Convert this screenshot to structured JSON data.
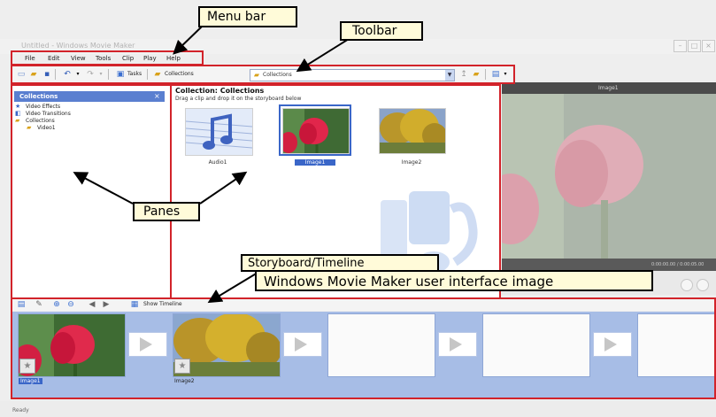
{
  "window": {
    "title": "Untitled - Windows Movie Maker",
    "controls": [
      "minimize",
      "maximize",
      "close"
    ]
  },
  "menu": {
    "items": [
      "File",
      "Edit",
      "View",
      "Tools",
      "Clip",
      "Play",
      "Help"
    ]
  },
  "toolbar": {
    "tasks_label": "Tasks",
    "collections_label": "Collections",
    "collection_combo_value": "Collections"
  },
  "collections_pane": {
    "title": "Collections",
    "tree": [
      {
        "label": "Video Effects",
        "icon": "star-icon",
        "level": 0
      },
      {
        "label": "Video Transitions",
        "icon": "transition-icon",
        "level": 0
      },
      {
        "label": "Collections",
        "icon": "folder-icon",
        "level": 0
      },
      {
        "label": "Video1",
        "icon": "folder-icon",
        "level": 1
      }
    ]
  },
  "contents_pane": {
    "title": "Collection: Collections",
    "subtitle": "Drag a clip and drop it on the storyboard below",
    "clips": [
      {
        "label": "Audio1",
        "kind": "audio"
      },
      {
        "label": "Image1",
        "kind": "tulip",
        "selected": true
      },
      {
        "label": "Image2",
        "kind": "tree"
      }
    ]
  },
  "preview": {
    "title": "Image1",
    "time": "0:00:00.00 / 0:00:05.00"
  },
  "storyboard": {
    "show_timeline_label": "Show Timeline",
    "items": [
      {
        "label": "Image1",
        "kind": "tulip",
        "selected": true
      },
      {
        "label": "Image2",
        "kind": "tree",
        "selected": false
      },
      {
        "label": "",
        "kind": "empty",
        "selected": false
      },
      {
        "label": "",
        "kind": "empty",
        "selected": false
      },
      {
        "label": "",
        "kind": "empty",
        "selected": false
      }
    ]
  },
  "status": {
    "text": "Ready"
  },
  "callouts": {
    "menu_bar": "Menu bar",
    "toolbar": "Toolbar",
    "panes": "Panes",
    "storyboard": "Storyboard/Timeline",
    "caption": "Windows Movie Maker user interface image"
  },
  "colors": {
    "highlight_red": "#d2232a",
    "callout_fill": "#fffbd9",
    "pane_header_blue": "#5a7fd0",
    "storyboard_blue": "#a7bde6"
  }
}
